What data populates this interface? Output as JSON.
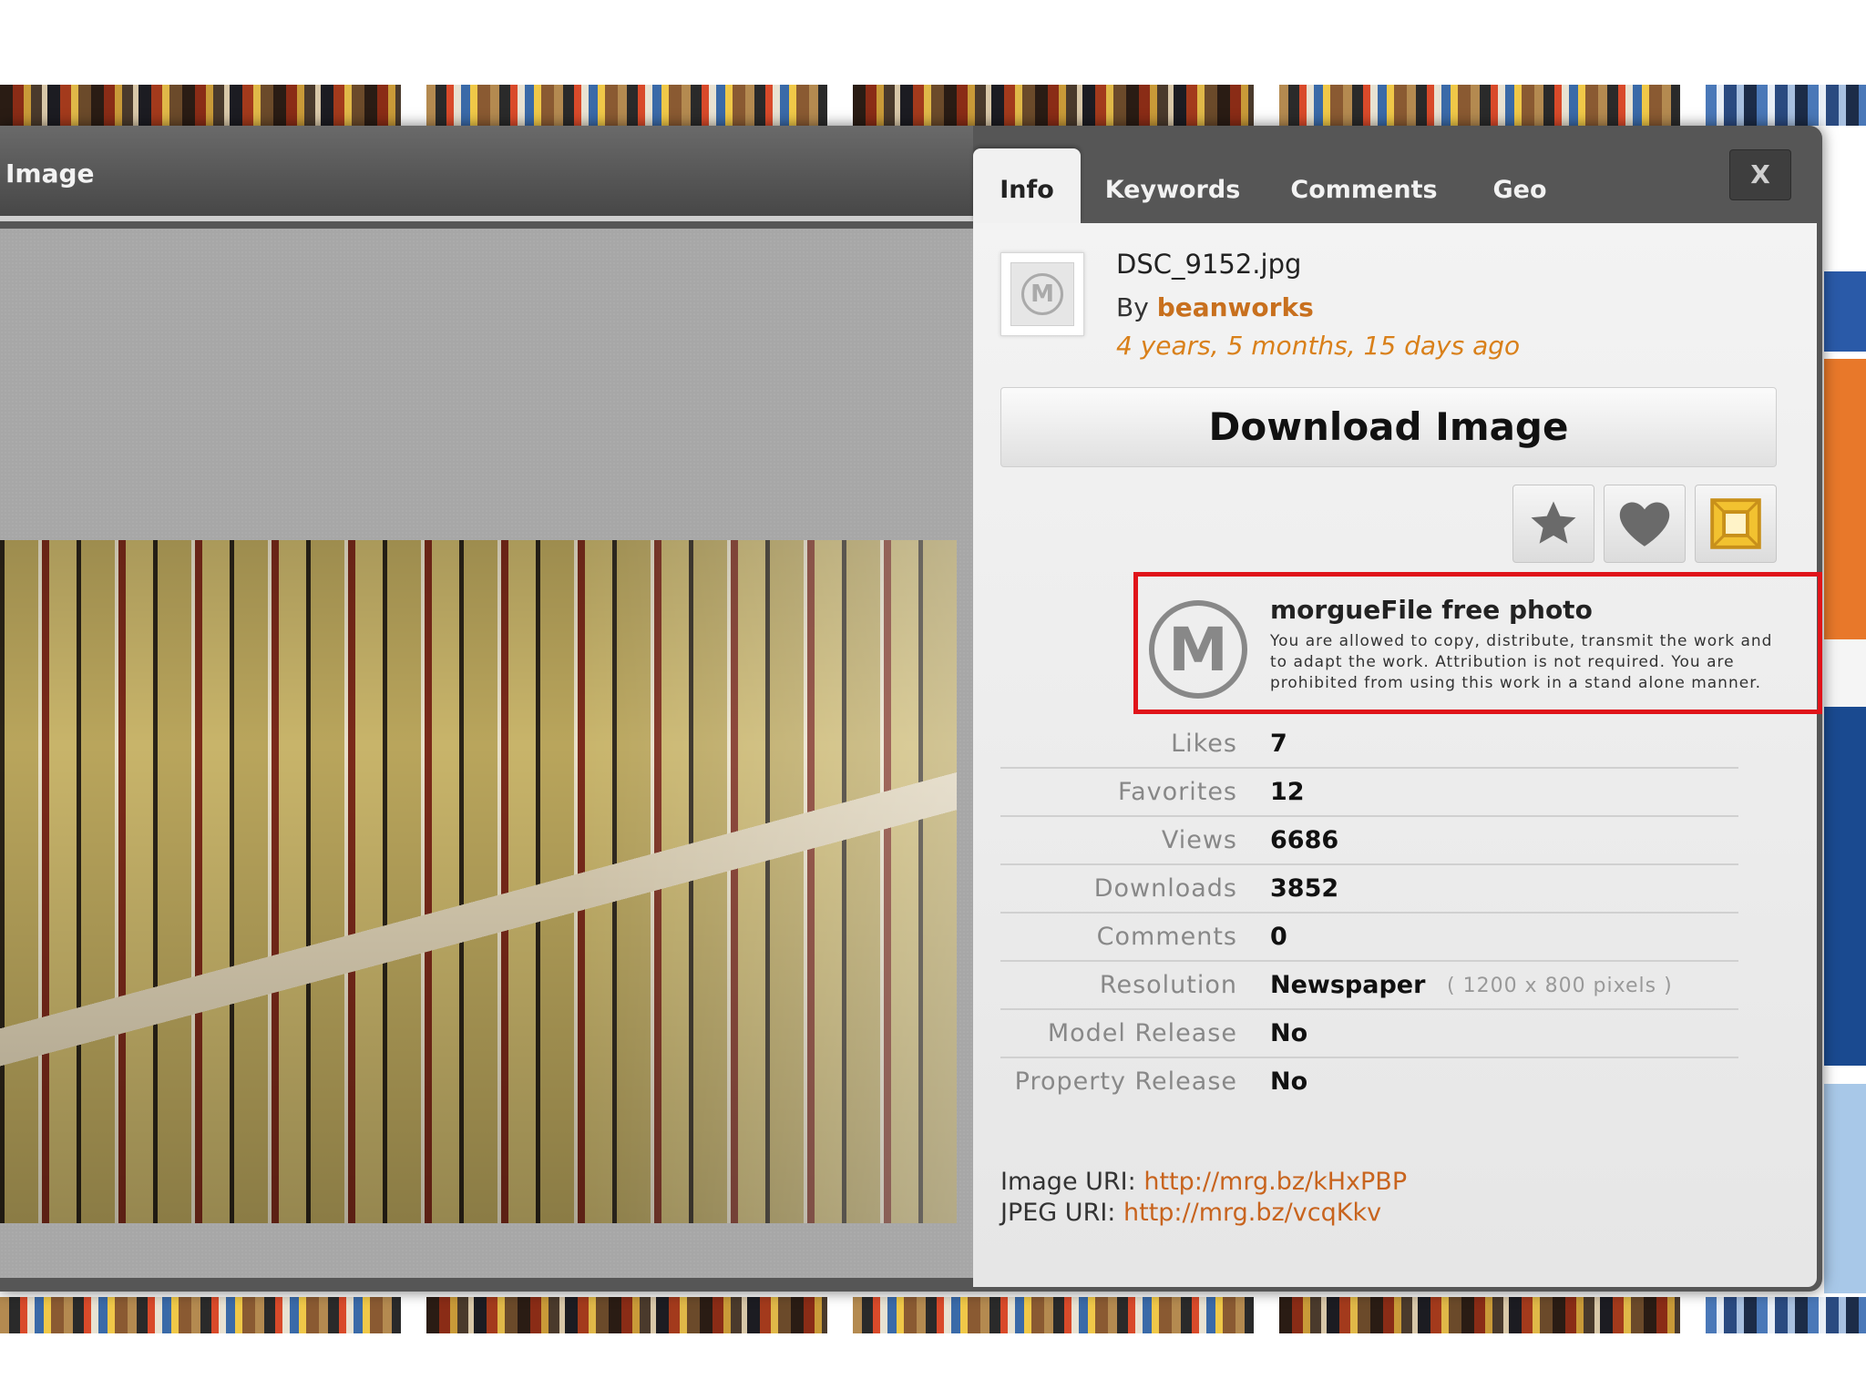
{
  "modal": {
    "title": "Image",
    "close_label": "X",
    "tabs": [
      "Info",
      "Keywords",
      "Comments",
      "Geo"
    ]
  },
  "info": {
    "avatar_letter": "M",
    "filename": "DSC_9152.jpg",
    "by_label": "By",
    "author": "beanworks",
    "age": "4 years, 5 months, 15 days ago",
    "download_label": "Download Image",
    "icons": [
      "star-icon",
      "heart-icon",
      "crop-icon"
    ]
  },
  "license": {
    "logo_letter": "M",
    "title": "morgueFile free photo",
    "text": "You are allowed to copy, distribute, transmit the work and to adapt the work. Attribution is not required. You are prohibited from using this work in a stand alone manner."
  },
  "stats": [
    {
      "label": "Likes",
      "value": "7"
    },
    {
      "label": "Favorites",
      "value": "12"
    },
    {
      "label": "Views",
      "value": "6686"
    },
    {
      "label": "Downloads",
      "value": "3852"
    },
    {
      "label": "Comments",
      "value": "0"
    },
    {
      "label": "Resolution",
      "value": "Newspaper",
      "extra": "( 1200 x 800 pixels )"
    },
    {
      "label": "Model Release",
      "value": "No"
    },
    {
      "label": "Property Release",
      "value": "No"
    }
  ],
  "uris": [
    {
      "label": "Image URI:",
      "url": "http://mrg.bz/kHxPBP"
    },
    {
      "label": "JPEG URI:",
      "url": "http://mrg.bz/vcqKkv"
    }
  ],
  "colors": {
    "accent_orange": "#c8701e",
    "highlight_red": "#e0141a"
  }
}
